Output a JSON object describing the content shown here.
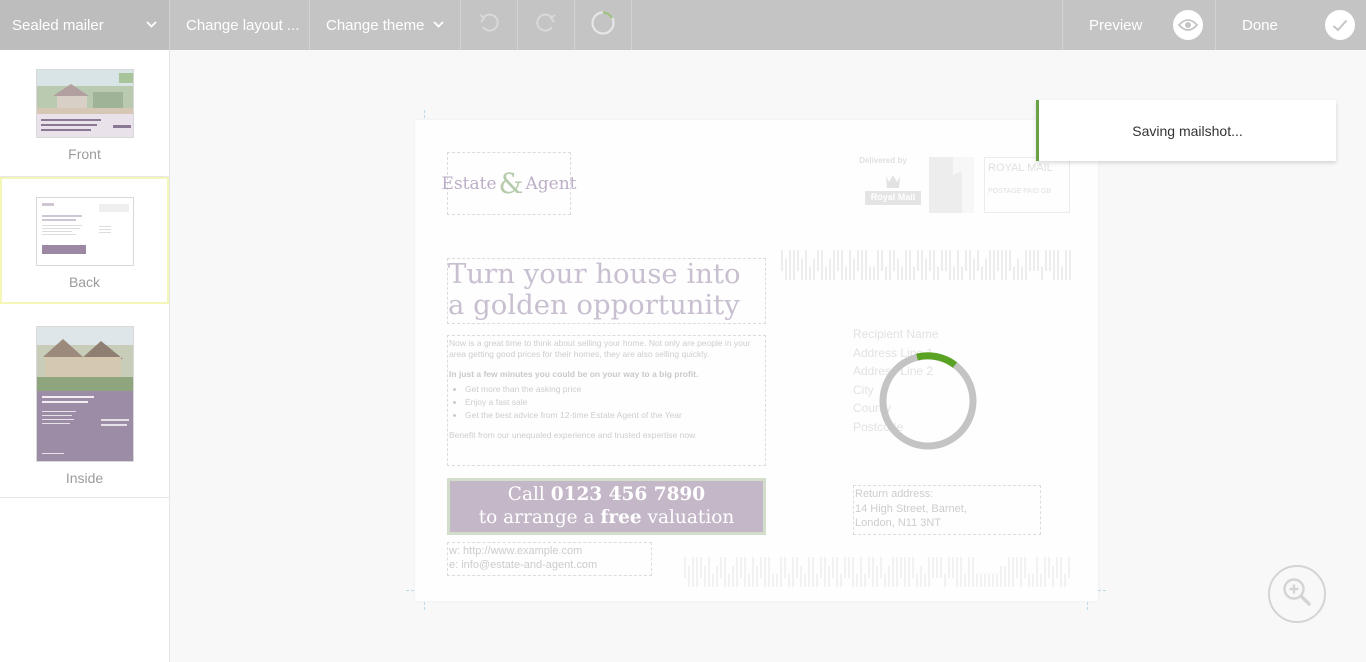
{
  "toolbar": {
    "product_label": "Sealed mailer",
    "change_layout_label": "Change layout ...",
    "change_theme_label": "Change theme",
    "preview_label": "Preview",
    "done_label": "Done",
    "icons": [
      "chevron-down-icon",
      "undo-icon",
      "redo-icon",
      "loading-ring-icon",
      "eye-icon",
      "check-icon"
    ]
  },
  "sidebar": {
    "pages": [
      {
        "label": "Front",
        "selected": false
      },
      {
        "label": "Back",
        "selected": true
      },
      {
        "label": "Inside",
        "selected": false
      }
    ]
  },
  "mailer": {
    "logo": {
      "part1": "Estate",
      "amp": "&",
      "part2": "Agent"
    },
    "heading": "Turn your house into a golden opportunity",
    "intro": "Now is a great time to think about selling your home. Not only are people in your area getting good prices for their homes, they are also selling quickly.",
    "lead": "In just a few minutes you could be on your way to a big profit.",
    "bullets": [
      "Get more than the asking price",
      "Enjoy a fast sale",
      "Get the best advice from 12-time Estate Agent of the Year"
    ],
    "closing": "Benefit from our unequaled experience and trusted expertise now.",
    "cta": {
      "line1_prefix": "Call ",
      "phone": "0123 456 7890",
      "line2_prefix": "to arrange a ",
      "free": "free",
      "line2_suffix": " valuation"
    },
    "contact": {
      "web": "w: http://www.example.com",
      "email": "e: info@estate-and-agent.com"
    },
    "postage": {
      "delivered_by": "Delivered by",
      "royal_mail": "Royal Mail",
      "paid_title": "ROYAL MAIL",
      "paid_sub": "POSTAGE PAID GB"
    },
    "recipient": [
      "Recipient Name",
      "Address Line 1",
      "Address Line 2",
      "City",
      "County",
      "Postcode"
    ],
    "return_address": {
      "title": "Return address:",
      "line1": "14 High Street, Barnet,",
      "line2": "London, N11 3NT"
    }
  },
  "toast": {
    "message": "Saving mailshot..."
  },
  "colors": {
    "toolbar": "#c4c4c4",
    "toast_accent": "#69a346",
    "spinner_active": "#5aa224",
    "cta_bg": "#c4b7c8",
    "selected_thumb_border": "#f3f6b6"
  }
}
